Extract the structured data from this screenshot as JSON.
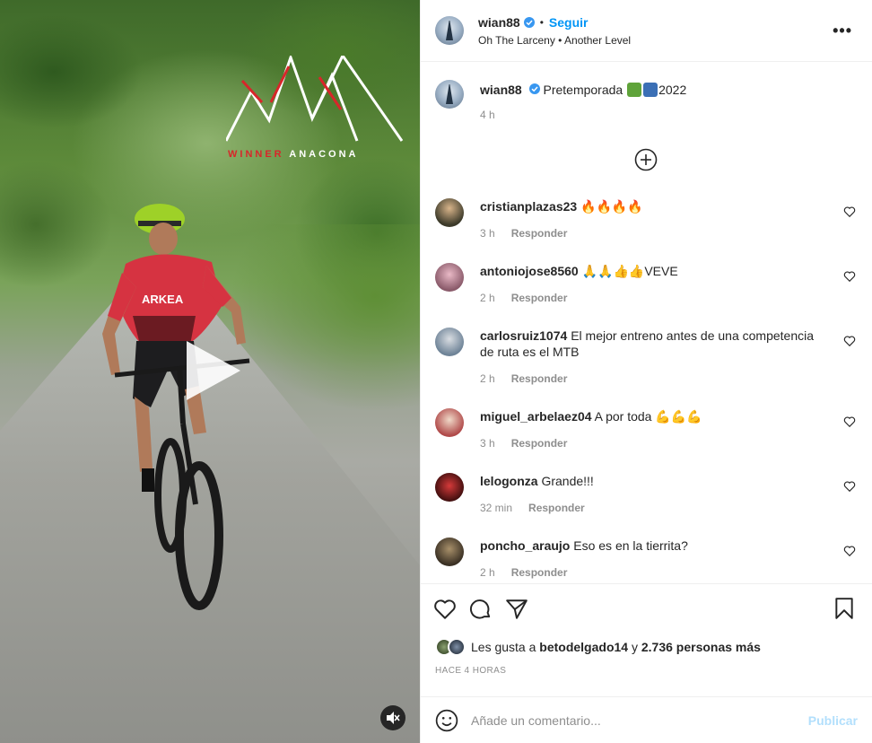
{
  "media": {
    "logo_text_red": "WINNER",
    "logo_text_white": "ANACONA",
    "jersey_brand": "ARKEA"
  },
  "header": {
    "username": "wian88",
    "separator": "•",
    "follow_label": "Seguir",
    "audio_line": "Oh The Larceny • Another Level",
    "more_label": "•••"
  },
  "caption": {
    "username": "wian88",
    "text": "Pretemporada",
    "year": "2022",
    "time": "4 h",
    "emoji_icons": [
      "biker-emoji",
      "soon-arrow-emoji"
    ]
  },
  "comments": [
    {
      "username": "cristianplazas23",
      "text": "🔥🔥🔥🔥",
      "time": "3 h",
      "reply": "Responder"
    },
    {
      "username": "antoniojose8560",
      "text": "🙏🙏👍👍VEVE",
      "time": "2 h",
      "reply": "Responder"
    },
    {
      "username": "carlosruiz1074",
      "text": "El mejor entreno antes de una competencia de ruta es el MTB",
      "time": "2 h",
      "reply": "Responder"
    },
    {
      "username": "miguel_arbelaez04",
      "text": "A por toda 💪💪💪",
      "time": "3 h",
      "reply": "Responder"
    },
    {
      "username": "lelogonza",
      "text": "Grande!!!",
      "time": "32 min",
      "reply": "Responder"
    },
    {
      "username": "poncho_araujo",
      "text": "Eso es en la tierrita?",
      "time": "2 h",
      "reply": "Responder"
    }
  ],
  "likes": {
    "prefix": "Les gusta a",
    "user": "betodelgado14",
    "middle": "y",
    "count_text": "2.736 personas más"
  },
  "posted_ago": "HACE 4 HORAS",
  "add_comment": {
    "placeholder": "Añade un comentario...",
    "publish_label": "Publicar"
  },
  "colors": {
    "accent": "#0095f6",
    "publish_disabled": "#b2dffc",
    "muted": "#8e8e8e",
    "text": "#262626"
  }
}
